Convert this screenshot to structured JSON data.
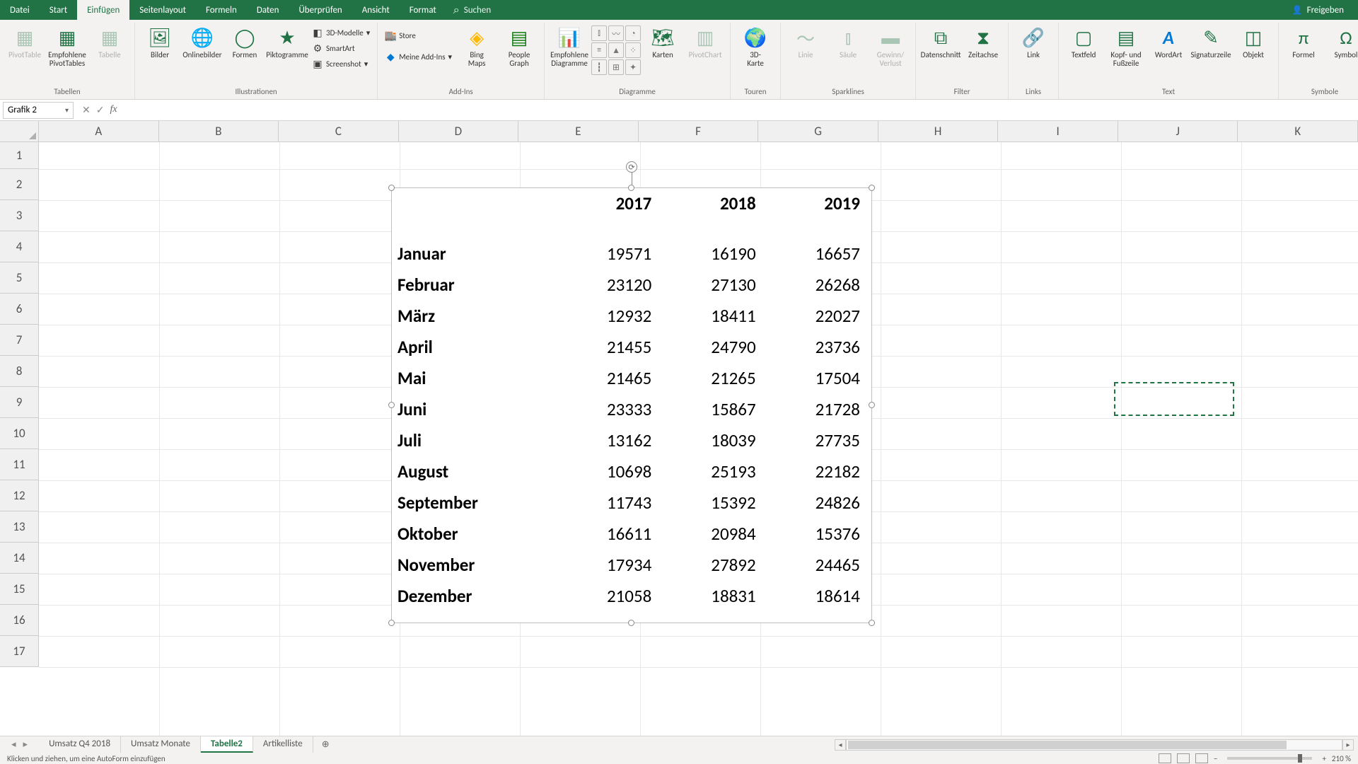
{
  "menu": {
    "datei": "Datei",
    "start": "Start",
    "einfugen": "Einfügen",
    "seitenlayout": "Seitenlayout",
    "formeln": "Formeln",
    "daten": "Daten",
    "uberprufen": "Überprüfen",
    "ansicht": "Ansicht",
    "format": "Format",
    "suchen": "Suchen",
    "freigeben": "Freigeben"
  },
  "ribbon": {
    "pivottable": "PivotTable",
    "emp_pivot": "Empfohlene\nPivotTables",
    "tabelle": "Tabelle",
    "tabellen": "Tabellen",
    "bilder": "Bilder",
    "onlinebilder": "Onlinebilder",
    "formen": "Formen",
    "piktogramme": "Piktogramme",
    "models": "3D-Modelle",
    "smartart": "SmartArt",
    "screenshot": "Screenshot",
    "illustrationen": "Illustrationen",
    "store": "Store",
    "meine_addins": "Meine Add-Ins",
    "addins": "Add-Ins",
    "bingmaps": "Bing\nMaps",
    "peoplegraph": "People\nGraph",
    "emp_diagramme": "Empfohlene\nDiagramme",
    "karten": "Karten",
    "pivotchart": "PivotChart",
    "diagramme": "Diagramme",
    "dkarte": "3D-\nKarte",
    "touren": "Touren",
    "linie": "Linie",
    "saule": "Säule",
    "gewinn": "Gewinn/\nVerlust",
    "sparklines": "Sparklines",
    "datenschnitt": "Datenschnitt",
    "zeitachse": "Zeitachse",
    "filter": "Filter",
    "link": "Link",
    "links": "Links",
    "textfeld": "Textfeld",
    "kopfzeile": "Kopf- und\nFußzeile",
    "wordart": "WordArt",
    "signatur": "Signaturzeile",
    "objekt": "Objekt",
    "text": "Text",
    "formel": "Formel",
    "symbol": "Symbol",
    "symbole": "Symbole"
  },
  "namebox": "Grafik 2",
  "columns": [
    "A",
    "B",
    "C",
    "D",
    "E",
    "F",
    "G",
    "H",
    "I",
    "J",
    "K"
  ],
  "rows": [
    "1",
    "2",
    "3",
    "4",
    "5",
    "6",
    "7",
    "8",
    "9",
    "10",
    "11",
    "12",
    "13",
    "14",
    "15",
    "16",
    "17"
  ],
  "chart_data": {
    "type": "table",
    "title": "",
    "columns": [
      "2017",
      "2018",
      "2019"
    ],
    "rows": [
      {
        "label": "Januar",
        "values": [
          19571,
          16190,
          16657
        ]
      },
      {
        "label": "Februar",
        "values": [
          23120,
          27130,
          26268
        ]
      },
      {
        "label": "März",
        "values": [
          12932,
          18411,
          22027
        ]
      },
      {
        "label": "April",
        "values": [
          21455,
          24790,
          23736
        ]
      },
      {
        "label": "Mai",
        "values": [
          21465,
          21265,
          17504
        ]
      },
      {
        "label": "Juni",
        "values": [
          23333,
          15867,
          21728
        ]
      },
      {
        "label": "Juli",
        "values": [
          13162,
          18039,
          27735
        ]
      },
      {
        "label": "August",
        "values": [
          10698,
          25193,
          22182
        ]
      },
      {
        "label": "September",
        "values": [
          11743,
          15392,
          24826
        ]
      },
      {
        "label": "Oktober",
        "values": [
          16611,
          20984,
          15376
        ]
      },
      {
        "label": "November",
        "values": [
          17934,
          27892,
          24465
        ]
      },
      {
        "label": "Dezember",
        "values": [
          21058,
          18831,
          18614
        ]
      }
    ]
  },
  "sheets": {
    "umsatz_q4": "Umsatz Q4 2018",
    "umsatz_monate": "Umsatz Monate",
    "tabelle2": "Tabelle2",
    "artikelliste": "Artikelliste"
  },
  "status": "Klicken und ziehen, um eine AutoForm einzufügen",
  "zoom": "210 %"
}
